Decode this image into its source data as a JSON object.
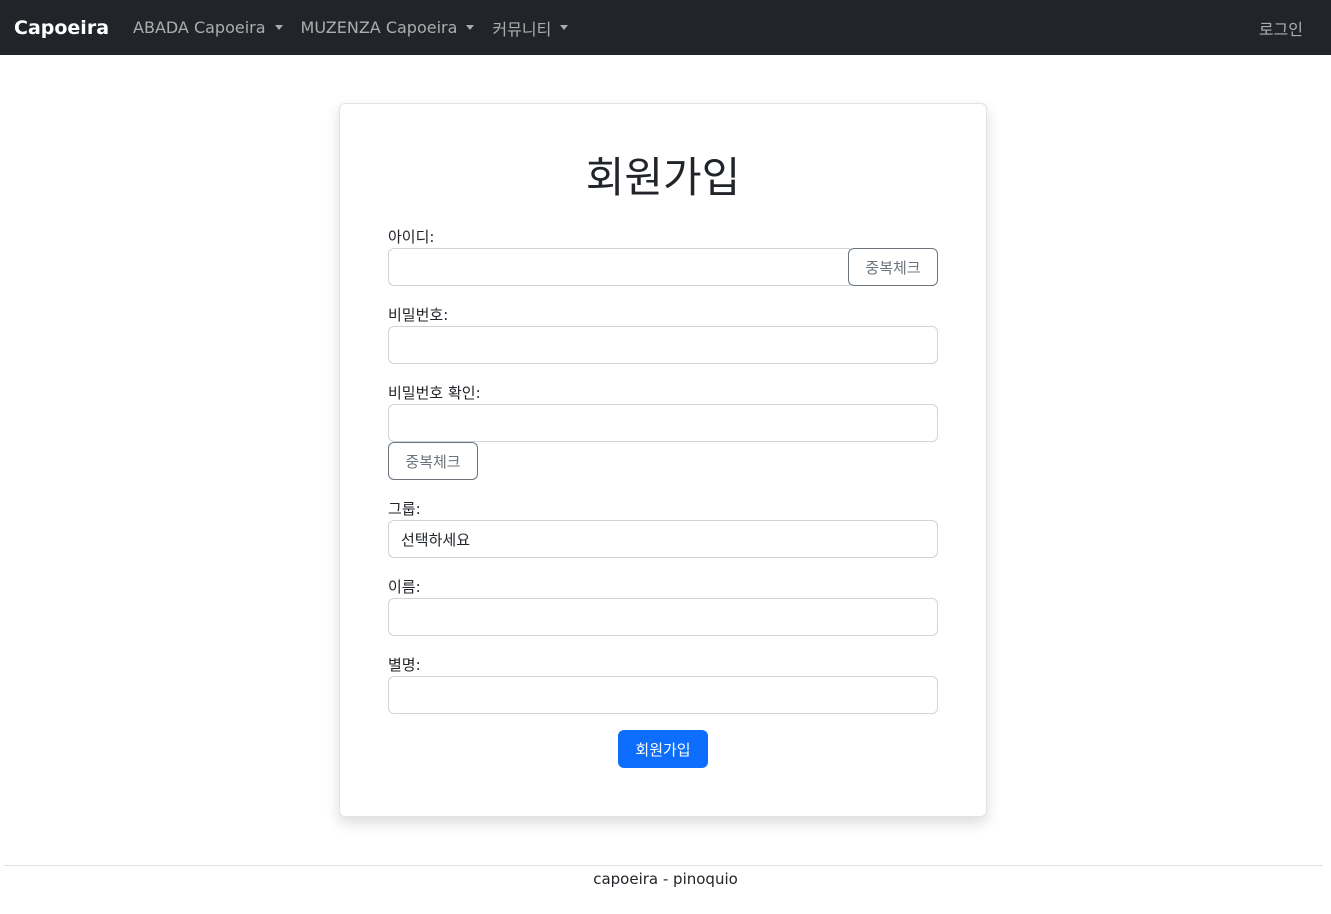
{
  "navbar": {
    "brand": "Capoeira",
    "items": [
      {
        "label": "ABADA Capoeira"
      },
      {
        "label": "MUZENZA Capoeira"
      },
      {
        "label": "커뮤니티"
      }
    ],
    "login": "로그인"
  },
  "form": {
    "title": "회원가입",
    "id_label": "아이디:",
    "id_value": "",
    "id_check_button": "중복체크",
    "password_label": "비밀번호:",
    "password_value": "",
    "password_confirm_label": "비밀번호 확인:",
    "password_confirm_value": "",
    "password_check_button": "중복체크",
    "group_label": "그룹:",
    "group_selected": "선택하세요",
    "name_label": "이름:",
    "name_value": "",
    "nickname_label": "별명:",
    "nickname_value": "",
    "submit_button": "회원가입"
  },
  "footer": {
    "text": "capoeira - pinoquio"
  },
  "colors": {
    "navbar_bg": "#212529",
    "primary": "#0d6efd",
    "secondary": "#6c757d"
  }
}
